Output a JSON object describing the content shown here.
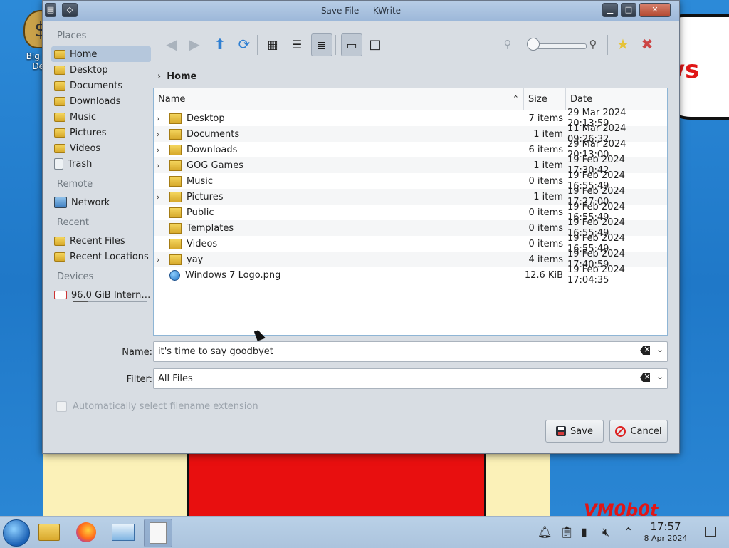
{
  "desktop": {
    "icon_label": "Big Mo\nDeli",
    "watermark_ys": "ys",
    "watermark_vm": "VM0b0t"
  },
  "window": {
    "title": "Save File — KWrite"
  },
  "sidebar": {
    "sections": [
      {
        "title": "Places",
        "items": [
          {
            "label": "Home",
            "icon": "home-folder-icon",
            "active": true
          },
          {
            "label": "Desktop",
            "icon": "desktop-folder-icon"
          },
          {
            "label": "Documents",
            "icon": "documents-folder-icon"
          },
          {
            "label": "Downloads",
            "icon": "downloads-folder-icon"
          },
          {
            "label": "Music",
            "icon": "music-folder-icon"
          },
          {
            "label": "Pictures",
            "icon": "pictures-folder-icon"
          },
          {
            "label": "Videos",
            "icon": "videos-folder-icon"
          },
          {
            "label": "Trash",
            "icon": "trash-icon"
          }
        ]
      },
      {
        "title": "Remote",
        "items": [
          {
            "label": "Network",
            "icon": "network-icon"
          }
        ]
      },
      {
        "title": "Recent",
        "items": [
          {
            "label": "Recent Files",
            "icon": "recent-files-icon"
          },
          {
            "label": "Recent Locations",
            "icon": "recent-locations-icon"
          }
        ]
      },
      {
        "title": "Devices",
        "items": [
          {
            "label": "96.0 GiB Intern…",
            "icon": "drive-icon"
          }
        ]
      }
    ],
    "drive_usage_fraction": 0.2
  },
  "toolbar": {
    "buttons": [
      "back-icon",
      "forward-icon",
      "parent-folder-icon",
      "reload-icon",
      "icons-view-icon",
      "compact-view-icon",
      "detailed-view-icon",
      "preview-icon",
      "panel-icon",
      "zoom-out-icon",
      "zoom-in-icon",
      "new-folder-icon",
      "options-icon"
    ],
    "zoom_level_fraction": 0.05
  },
  "breadcrumb": {
    "current": "Home"
  },
  "file_list": {
    "columns": {
      "name": "Name",
      "size": "Size",
      "date": "Date"
    },
    "sort_column": "Name",
    "sort_order": "ascending",
    "rows": [
      {
        "name": "Desktop",
        "size": "7 items",
        "date": "29 Mar 2024 20:13:59",
        "expandable": true
      },
      {
        "name": "Documents",
        "size": "1 item",
        "date": "11 Mar 2024 09:26:32",
        "expandable": true
      },
      {
        "name": "Downloads",
        "size": "6 items",
        "date": "29 Mar 2024 20:13:00",
        "expandable": true
      },
      {
        "name": "GOG Games",
        "size": "1 item",
        "date": "19 Feb 2024 17:30:42",
        "expandable": true
      },
      {
        "name": "Music",
        "size": "0 items",
        "date": "19 Feb 2024 16:55:49",
        "expandable": false
      },
      {
        "name": "Pictures",
        "size": "1 item",
        "date": "19 Feb 2024 17:27:00",
        "expandable": true
      },
      {
        "name": "Public",
        "size": "0 items",
        "date": "19 Feb 2024 16:55:49",
        "expandable": false
      },
      {
        "name": "Templates",
        "size": "0 items",
        "date": "19 Feb 2024 16:55:49",
        "expandable": false
      },
      {
        "name": "Videos",
        "size": "0 items",
        "date": "19 Feb 2024 16:55:49",
        "expandable": false
      },
      {
        "name": "yay",
        "size": "4 items",
        "date": "19 Feb 2024 17:40:59",
        "expandable": true
      },
      {
        "name": "Windows 7 Logo.png",
        "size": "12.6 KiB",
        "date": "19 Feb 2024 17:04:35",
        "expandable": false,
        "file": true
      }
    ]
  },
  "name_field": {
    "label": "Name:",
    "value": "it's time to say goodbyet"
  },
  "filter_field": {
    "label": "Filter:",
    "value": "All Files"
  },
  "auto_extension": {
    "label": "Automatically select filename extension",
    "checked": false,
    "enabled": false
  },
  "buttons": {
    "save": "Save",
    "cancel": "Cancel"
  },
  "taskbar": {
    "apps": [
      "file-manager-icon",
      "firefox-icon",
      "system-settings-icon",
      "kwrite-icon"
    ],
    "tray": [
      "notifications-icon",
      "clipboard-icon",
      "battery-icon",
      "volume-muted-icon",
      "tray-expand-icon"
    ],
    "time": "17:57",
    "date": "8 Apr 2024"
  },
  "colors": {
    "selection": "#b5c7dc",
    "accent_border": "#8eb5d5",
    "wallpaper_blue": "#2c8ad8"
  }
}
